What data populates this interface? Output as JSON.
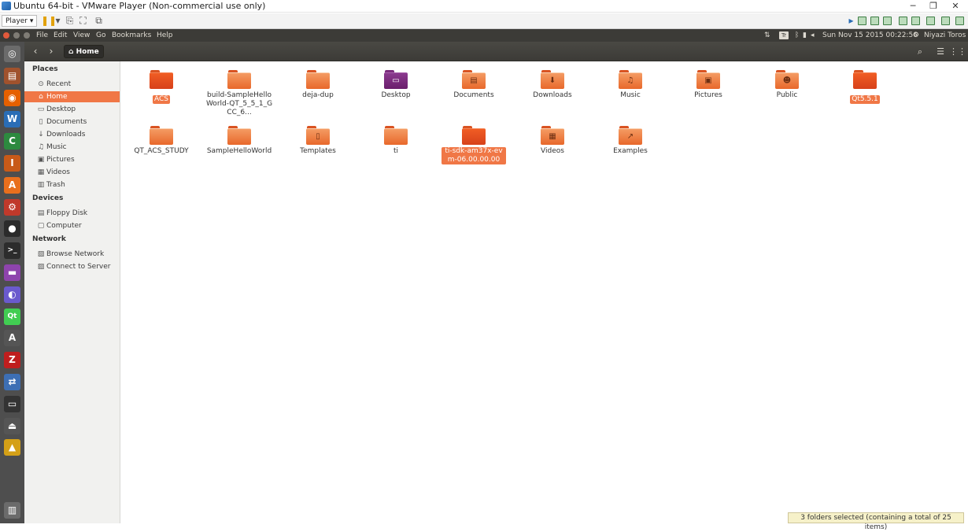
{
  "vm": {
    "title": "Ubuntu 64-bit - VMware Player (Non-commercial use only)",
    "player_menu": "Player ▾",
    "controls": {
      "minimize": "─",
      "restore": "❐",
      "close": "✕"
    }
  },
  "topbar": {
    "menu": [
      "File",
      "Edit",
      "View",
      "Go",
      "Bookmarks",
      "Help"
    ],
    "keyboard": "Tr",
    "datetime": "Sun Nov 15 2015 00:22:56",
    "user": "Niyazi Toros"
  },
  "nautilus": {
    "breadcrumb": "Home",
    "back": "‹",
    "forward": "›"
  },
  "sidebar": {
    "places_heading": "Places",
    "places": [
      {
        "icon": "clock-icon",
        "glyph": "⊙",
        "label": "Recent"
      },
      {
        "icon": "home-icon",
        "glyph": "⌂",
        "label": "Home",
        "active": true
      },
      {
        "icon": "desktop-icon",
        "glyph": "▭",
        "label": "Desktop"
      },
      {
        "icon": "document-icon",
        "glyph": "▯",
        "label": "Documents"
      },
      {
        "icon": "download-icon",
        "glyph": "↓",
        "label": "Downloads"
      },
      {
        "icon": "music-icon",
        "glyph": "♫",
        "label": "Music"
      },
      {
        "icon": "camera-icon",
        "glyph": "▣",
        "label": "Pictures"
      },
      {
        "icon": "film-icon",
        "glyph": "▦",
        "label": "Videos"
      },
      {
        "icon": "trash-icon",
        "glyph": "▥",
        "label": "Trash"
      }
    ],
    "devices_heading": "Devices",
    "devices": [
      {
        "icon": "floppy-icon",
        "glyph": "▤",
        "label": "Floppy Disk"
      },
      {
        "icon": "computer-icon",
        "glyph": "▢",
        "label": "Computer"
      }
    ],
    "network_heading": "Network",
    "network": [
      {
        "icon": "network-icon",
        "glyph": "▧",
        "label": "Browse Network"
      },
      {
        "icon": "server-icon",
        "glyph": "▨",
        "label": "Connect to Server"
      }
    ]
  },
  "files": [
    {
      "name": "ACS",
      "selected": true,
      "style": "dark",
      "icon": "folder-icon"
    },
    {
      "name": "build-SampleHelloWorld-QT_5_5_1_GCC_6...",
      "style": "plain",
      "icon": "folder-icon"
    },
    {
      "name": "deja-dup",
      "style": "plain",
      "icon": "folder-icon"
    },
    {
      "name": "Desktop",
      "style": "desk",
      "icon": "folder-desktop-icon",
      "emblem": "▭"
    },
    {
      "name": "Documents",
      "style": "plain",
      "icon": "folder-documents-icon",
      "emblem": "▤"
    },
    {
      "name": "Downloads",
      "style": "plain",
      "icon": "folder-downloads-icon",
      "emblem": "⬇"
    },
    {
      "name": "Music",
      "style": "plain",
      "icon": "folder-music-icon",
      "emblem": "♫"
    },
    {
      "name": "Pictures",
      "style": "plain",
      "icon": "folder-pictures-icon",
      "emblem": "▣"
    },
    {
      "name": "Public",
      "style": "plain",
      "icon": "folder-public-icon",
      "emblem": "☻"
    },
    {
      "name": "Qt5.5.1",
      "selected": true,
      "style": "dark",
      "icon": "folder-icon"
    },
    {
      "name": "QT_ACS_STUDY",
      "style": "plain",
      "icon": "folder-icon"
    },
    {
      "name": "SampleHelloWorld",
      "style": "plain",
      "icon": "folder-icon"
    },
    {
      "name": "Templates",
      "style": "plain",
      "icon": "folder-templates-icon",
      "emblem": "▯"
    },
    {
      "name": "ti",
      "style": "plain",
      "icon": "folder-icon"
    },
    {
      "name": "ti-sdk-am37x-evm-06.00.00.00",
      "selected": true,
      "style": "dark",
      "icon": "folder-icon"
    },
    {
      "name": "Videos",
      "style": "plain",
      "icon": "folder-videos-icon",
      "emblem": "▦"
    },
    {
      "name": "Examples",
      "style": "plain",
      "icon": "folder-link-icon",
      "emblem": "↗"
    }
  ],
  "status": "3 folders selected  (containing a total of 25 items)",
  "launcher": [
    {
      "name": "dash-icon",
      "glyph": "◎",
      "bg": "#6b6b6b"
    },
    {
      "name": "files-icon",
      "glyph": "▤",
      "bg": "#a0522d"
    },
    {
      "name": "firefox-icon",
      "glyph": "◉",
      "bg": "#e66000"
    },
    {
      "name": "writer-icon",
      "glyph": "W",
      "bg": "#2a6db5"
    },
    {
      "name": "calc-icon",
      "glyph": "C",
      "bg": "#2d8a3f"
    },
    {
      "name": "impress-icon",
      "glyph": "I",
      "bg": "#c85a18"
    },
    {
      "name": "software-center-icon",
      "glyph": "A",
      "bg": "#e86f1d"
    },
    {
      "name": "settings-icon",
      "glyph": "⚙",
      "bg": "#c0392b"
    },
    {
      "name": "dark-app-icon",
      "glyph": "●",
      "bg": "#2b2b2b"
    },
    {
      "name": "terminal-icon",
      "glyph": ">_",
      "bg": "#2c2c2c"
    },
    {
      "name": "purple-app-icon",
      "glyph": "▬",
      "bg": "#8e44ad"
    },
    {
      "name": "eclipse-icon",
      "glyph": "◐",
      "bg": "#6a5acd"
    },
    {
      "name": "qtcreator-icon",
      "glyph": "Qt",
      "bg": "#41cd52"
    },
    {
      "name": "update-icon",
      "glyph": "A",
      "bg": "#555555"
    },
    {
      "name": "filezilla-icon",
      "glyph": "Z",
      "bg": "#bf1e1e"
    },
    {
      "name": "network-app-icon",
      "glyph": "⇄",
      "bg": "#3d6fb4"
    },
    {
      "name": "device-icon",
      "glyph": "▭",
      "bg": "#333333"
    },
    {
      "name": "usb-icon",
      "glyph": "⏏",
      "bg": "#555555"
    },
    {
      "name": "image-viewer-icon",
      "glyph": "▲",
      "bg": "#d4a017"
    },
    {
      "name": "trash-launcher-icon",
      "glyph": "▥",
      "bg": "#6b6b6b"
    }
  ]
}
